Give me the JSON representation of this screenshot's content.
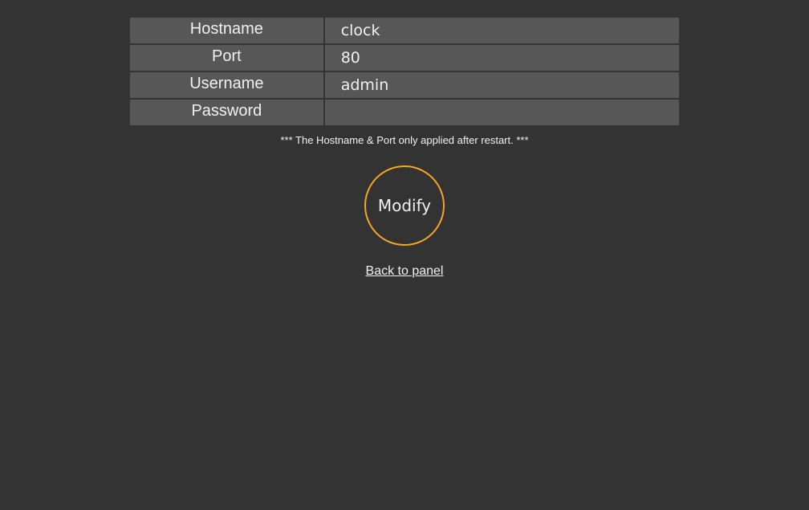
{
  "form": {
    "rows": [
      {
        "label": "Hostname",
        "value": "clock"
      },
      {
        "label": "Port",
        "value": "80"
      },
      {
        "label": "Username",
        "value": "admin"
      },
      {
        "label": "Password",
        "value": ""
      }
    ]
  },
  "note": "*** The Hostname & Port only applied after restart. ***",
  "modify_label": "Modify",
  "back_link_label": "Back to panel",
  "colors": {
    "background": "#333333",
    "field_bg": "#575757",
    "accent": "#f5a623",
    "text": "#f0f0f0"
  }
}
